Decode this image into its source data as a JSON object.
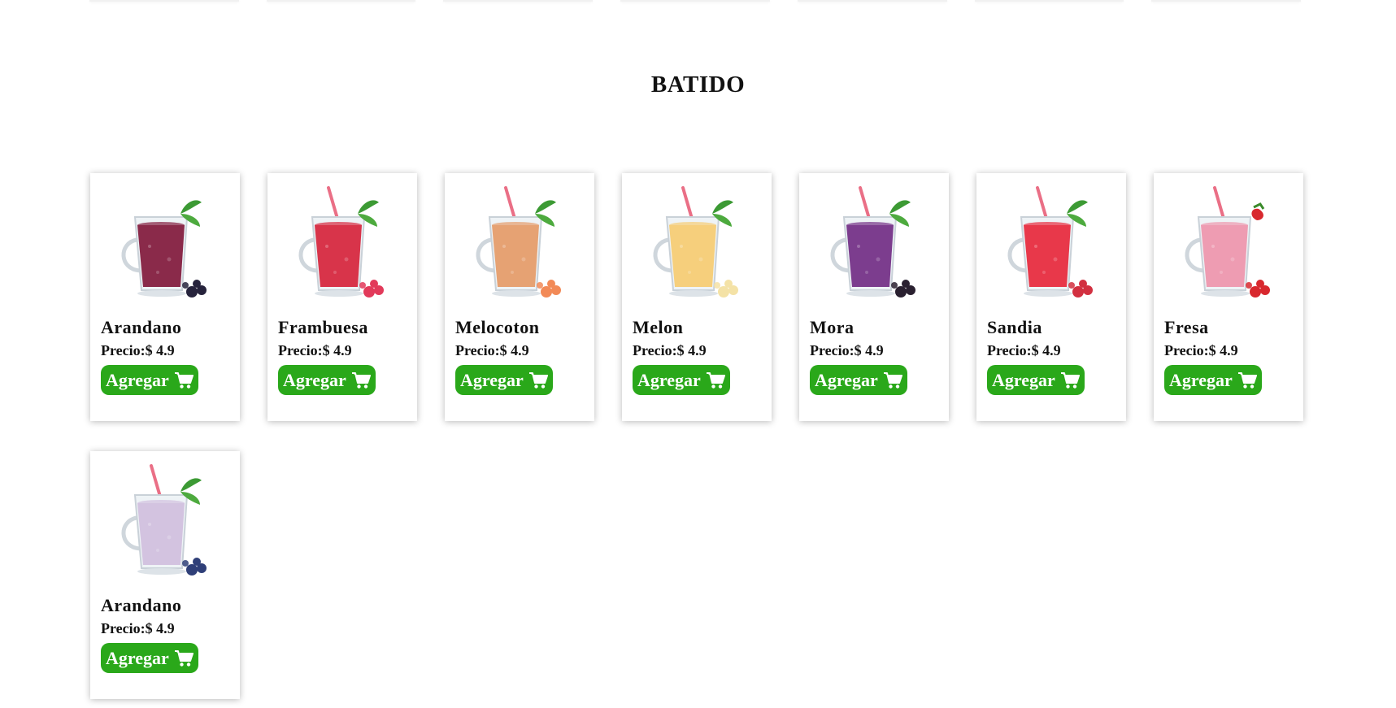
{
  "section": {
    "title": "BATIDO"
  },
  "products": [
    {
      "name": "Arandano",
      "price": "Precio:$ 4.9",
      "button": "Agregar",
      "liquid": "#8a2a4a",
      "fruit": "#26233c",
      "garnish": "mint",
      "icon": "cart-icon"
    },
    {
      "name": "Frambuesa",
      "price": "Precio:$ 4.9",
      "button": "Agregar",
      "liquid": "#d8344a",
      "fruit": "#e23a5a",
      "garnish": "straw-mint",
      "icon": "cart-icon"
    },
    {
      "name": "Melocoton",
      "price": "Precio:$ 4.9",
      "button": "Agregar",
      "liquid": "#e6a273",
      "fruit": "#f28a57",
      "garnish": "straw-mint",
      "icon": "cart-icon"
    },
    {
      "name": "Melon",
      "price": "Precio:$ 4.9",
      "button": "Agregar",
      "liquid": "#f6cf7c",
      "fruit": "#f4e2a6",
      "garnish": "straw-mint",
      "icon": "cart-icon"
    },
    {
      "name": "Mora",
      "price": "Precio:$ 4.9",
      "button": "Agregar",
      "liquid": "#7c3d8e",
      "fruit": "#2a2030",
      "garnish": "straw-mint",
      "icon": "cart-icon"
    },
    {
      "name": "Sandia",
      "price": "Precio:$ 4.9",
      "button": "Agregar",
      "liquid": "#e8384a",
      "fruit": "#d23040",
      "garnish": "straw-mint",
      "icon": "cart-icon"
    },
    {
      "name": "Fresa",
      "price": "Precio:$ 4.9",
      "button": "Agregar",
      "liquid": "#ee9cb2",
      "fruit": "#d8282e",
      "garnish": "straw-berry",
      "icon": "cart-icon"
    },
    {
      "name": "Arandano",
      "price": "Precio:$ 4.9",
      "button": "Agregar",
      "liquid": "#d3c3e0",
      "fruit": "#2f3f78",
      "garnish": "straw-mint",
      "icon": "cart-icon"
    }
  ],
  "colors": {
    "button_bg": "#2aa81a",
    "button_text": "#ffffff"
  }
}
